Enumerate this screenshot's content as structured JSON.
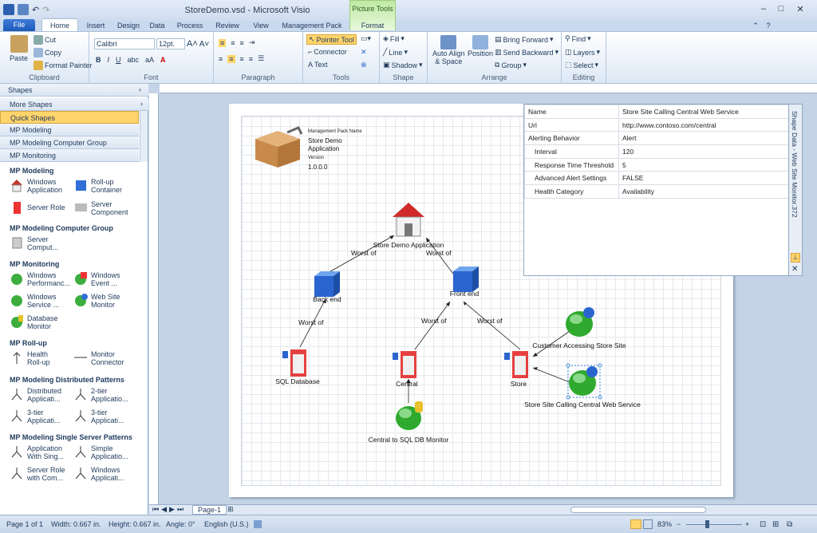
{
  "window": {
    "title": "StoreDemo.vsd - Microsoft Visio",
    "context_tab_group": "Picture Tools"
  },
  "tabs": [
    "File",
    "Home",
    "Insert",
    "Design",
    "Data",
    "Process",
    "Review",
    "View",
    "Management Pack",
    "Format"
  ],
  "ribbon": {
    "clipboard": {
      "paste": "Paste",
      "cut": "Cut",
      "copy": "Copy",
      "format_painter": "Format Painter",
      "label": "Clipboard"
    },
    "font": {
      "family": "Calibri",
      "size": "12pt.",
      "label": "Font"
    },
    "paragraph": {
      "label": "Paragraph"
    },
    "tools": {
      "pointer": "Pointer Tool",
      "connector": "Connector",
      "text": "Text",
      "label": "Tools"
    },
    "shape": {
      "fill": "Fill",
      "line": "Line",
      "shadow": "Shadow",
      "label": "Shape"
    },
    "arrange": {
      "auto_align": "Auto Align",
      "space": "& Space",
      "position": "Position",
      "bring_forward": "Bring Forward",
      "send_backward": "Send Backward",
      "group": "Group",
      "label": "Arrange"
    },
    "editing": {
      "find": "Find",
      "layers": "Layers",
      "select": "Select",
      "label": "Editing"
    }
  },
  "shapes_panel": {
    "title": "Shapes",
    "stencils": [
      "More Shapes",
      "Quick Shapes",
      "MP Modeling",
      "MP Modeling Computer Group",
      "MP Monitoring"
    ],
    "sections": [
      {
        "title": "MP Modeling",
        "items": [
          "Windows Application",
          "Roll-up Container",
          "Server Role",
          "Server Component"
        ]
      },
      {
        "title": "MP Modeling Computer Group",
        "items": [
          "Server Comput..."
        ]
      },
      {
        "title": "MP Monitoring",
        "items": [
          "Windows Performanc...",
          "Windows Event ...",
          "Windows Service ...",
          "Web Site Monitor",
          "Database Monitor"
        ]
      },
      {
        "title": "MP Roll-up",
        "items": [
          "Health Roll-up",
          "Monitor Connector"
        ]
      },
      {
        "title": "MP Modeling Distributed Patterns",
        "items": [
          "Distributed Applicati...",
          "2-tier Applicatio...",
          "3-tier Applicati...",
          "3-tier Applicati..."
        ]
      },
      {
        "title": "MP Modeling Single Server Patterns",
        "items": [
          "Application With Sing...",
          "Simple Applicatio...",
          "Server Role with Com...",
          "Windows Applicati..."
        ]
      }
    ]
  },
  "diagram": {
    "mp_header": {
      "name_label": "Management Pack Name",
      "name": "Store Demo Application",
      "version_label": "Version",
      "version": "1.0.0.0"
    },
    "nodes": {
      "app": "Store Demo Application",
      "backend": "Back end",
      "frontend": "Front end",
      "sqldb": "SQL Database",
      "central": "Central",
      "store": "Store",
      "customer": "Customer Accessing Store Site",
      "storesite": "Store Site Calling Central Web Service",
      "central_sql": "Central to SQL DB Monitor"
    },
    "edge_label": "Worst of"
  },
  "shape_data": {
    "title": "Shape Data - Web Site Monitor.372",
    "rows": [
      [
        "Name",
        "Store Site Calling Central Web Service"
      ],
      [
        "Url",
        "http://www.contoso.com/central"
      ],
      [
        "Alerting Behavior",
        "Alert"
      ],
      [
        "Interval",
        "120"
      ],
      [
        "Response Time Threshold",
        "5"
      ],
      [
        "Advanced Alert Settings",
        "FALSE"
      ],
      [
        "Health Category",
        "Availability"
      ]
    ]
  },
  "page_tab": "Page-1",
  "status": {
    "page": "Page 1 of 1",
    "width": "Width: 0.667 in.",
    "height": "Height: 0.667 in.",
    "angle": "Angle: 0°",
    "language": "English (U.S.)",
    "zoom": "83%"
  }
}
